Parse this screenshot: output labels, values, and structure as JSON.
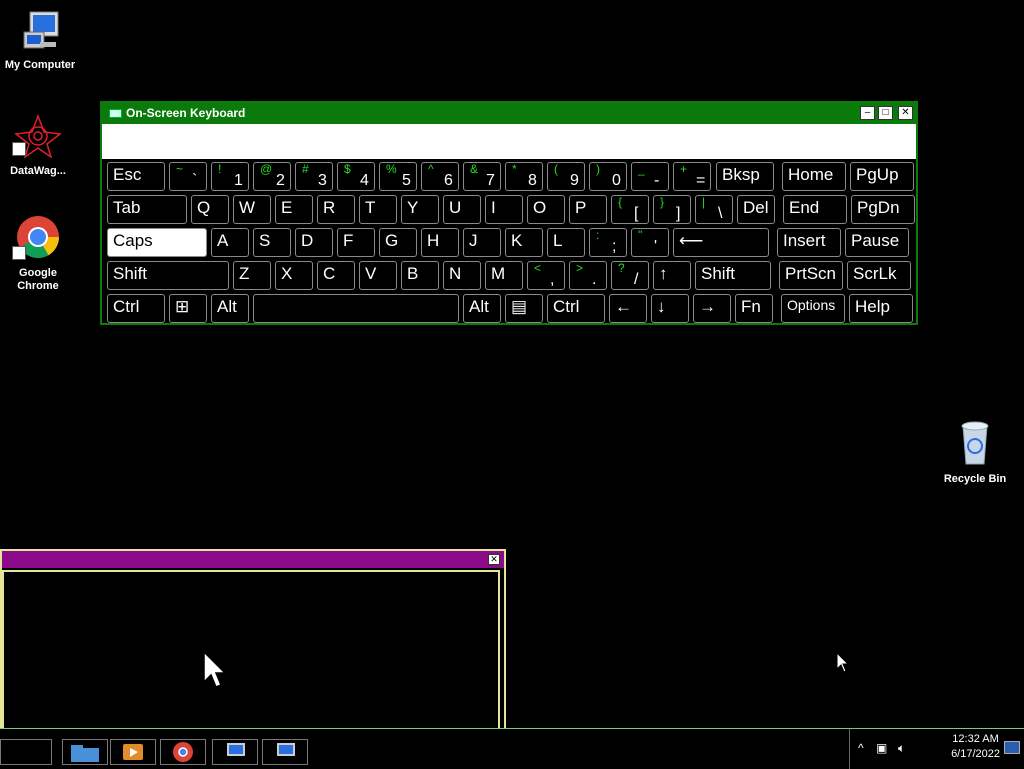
{
  "desktop": {
    "icons": [
      {
        "label": "My Computer"
      },
      {
        "label": "DataWag..."
      },
      {
        "label": "Google Chrome"
      },
      {
        "label": "Recycle Bin"
      }
    ]
  },
  "osk": {
    "title": "On-Screen Keyboard",
    "rows": [
      [
        {
          "id": "esc",
          "main": "Esc"
        },
        {
          "id": "backtick",
          "shift": "~",
          "base": "`"
        },
        {
          "id": "1",
          "shift": "!",
          "base": "1"
        },
        {
          "id": "2",
          "shift": "@",
          "base": "2"
        },
        {
          "id": "3",
          "shift": "#",
          "base": "3"
        },
        {
          "id": "4",
          "shift": "$",
          "base": "4"
        },
        {
          "id": "5",
          "shift": "%",
          "base": "5"
        },
        {
          "id": "6",
          "shift": "^",
          "base": "6"
        },
        {
          "id": "7",
          "shift": "&",
          "base": "7"
        },
        {
          "id": "8",
          "shift": "*",
          "base": "8"
        },
        {
          "id": "9",
          "shift": "(",
          "base": "9"
        },
        {
          "id": "0",
          "shift": ")",
          "base": "0"
        },
        {
          "id": "minus",
          "shift": "_",
          "base": "-"
        },
        {
          "id": "equals",
          "shift": "+",
          "base": "="
        },
        {
          "id": "bksp",
          "main": "Bksp"
        },
        {
          "id": "home",
          "main": "Home"
        },
        {
          "id": "pgup",
          "main": "PgUp"
        }
      ],
      [
        {
          "id": "tab",
          "main": "Tab"
        },
        {
          "id": "q",
          "main": "Q"
        },
        {
          "id": "w",
          "main": "W"
        },
        {
          "id": "e",
          "main": "E"
        },
        {
          "id": "r",
          "main": "R"
        },
        {
          "id": "t",
          "main": "T"
        },
        {
          "id": "y",
          "main": "Y"
        },
        {
          "id": "u",
          "main": "U"
        },
        {
          "id": "i",
          "main": "I"
        },
        {
          "id": "o",
          "main": "O"
        },
        {
          "id": "p",
          "main": "P"
        },
        {
          "id": "lbracket",
          "shift": "{",
          "base": "["
        },
        {
          "id": "rbracket",
          "shift": "}",
          "base": "]"
        },
        {
          "id": "backslash",
          "shift": "|",
          "base": "\\"
        },
        {
          "id": "del",
          "main": "Del"
        },
        {
          "id": "end",
          "main": "End"
        },
        {
          "id": "pgdn",
          "main": "PgDn"
        }
      ],
      [
        {
          "id": "caps",
          "main": "Caps"
        },
        {
          "id": "a",
          "main": "A"
        },
        {
          "id": "s",
          "main": "S"
        },
        {
          "id": "d",
          "main": "D"
        },
        {
          "id": "f",
          "main": "F"
        },
        {
          "id": "g",
          "main": "G"
        },
        {
          "id": "h",
          "main": "H"
        },
        {
          "id": "j",
          "main": "J"
        },
        {
          "id": "k",
          "main": "K"
        },
        {
          "id": "l",
          "main": "L"
        },
        {
          "id": "semicolon",
          "shift": ":",
          "base": ";"
        },
        {
          "id": "quote",
          "shift": "\"",
          "base": "'"
        },
        {
          "id": "enter",
          "main": "⟵"
        },
        {
          "id": "insert",
          "main": "Insert"
        },
        {
          "id": "pause",
          "main": "Pause"
        }
      ],
      [
        {
          "id": "lshift",
          "main": "Shift"
        },
        {
          "id": "z",
          "main": "Z"
        },
        {
          "id": "x",
          "main": "X"
        },
        {
          "id": "c",
          "main": "C"
        },
        {
          "id": "v",
          "main": "V"
        },
        {
          "id": "b",
          "main": "B"
        },
        {
          "id": "n",
          "main": "N"
        },
        {
          "id": "m",
          "main": "M"
        },
        {
          "id": "comma",
          "shift": "<",
          "base": ","
        },
        {
          "id": "period",
          "shift": ">",
          "base": "."
        },
        {
          "id": "slash",
          "shift": "?",
          "base": "/"
        },
        {
          "id": "up",
          "main": "↑"
        },
        {
          "id": "rshift",
          "main": "Shift"
        },
        {
          "id": "prtscn",
          "main": "PrtScn"
        },
        {
          "id": "scrlk",
          "main": "ScrLk"
        }
      ],
      [
        {
          "id": "lctrl",
          "main": "Ctrl"
        },
        {
          "id": "win",
          "main": "⊞"
        },
        {
          "id": "lalt",
          "main": "Alt"
        },
        {
          "id": "space",
          "main": ""
        },
        {
          "id": "ralt",
          "main": "Alt"
        },
        {
          "id": "menu",
          "main": "▤"
        },
        {
          "id": "rctrl",
          "main": "Ctrl"
        },
        {
          "id": "left",
          "main": "←"
        },
        {
          "id": "down",
          "main": "↓"
        },
        {
          "id": "right",
          "main": "→"
        },
        {
          "id": "fn",
          "main": "Fn"
        },
        {
          "id": "options",
          "main": "Options"
        },
        {
          "id": "help",
          "main": "Help"
        }
      ]
    ]
  },
  "tray": {
    "time": "12:32 AM",
    "date": "6/17/2022",
    "chevron": "^",
    "network_icon": "network-icon",
    "volume_icon": "volume-icon"
  }
}
